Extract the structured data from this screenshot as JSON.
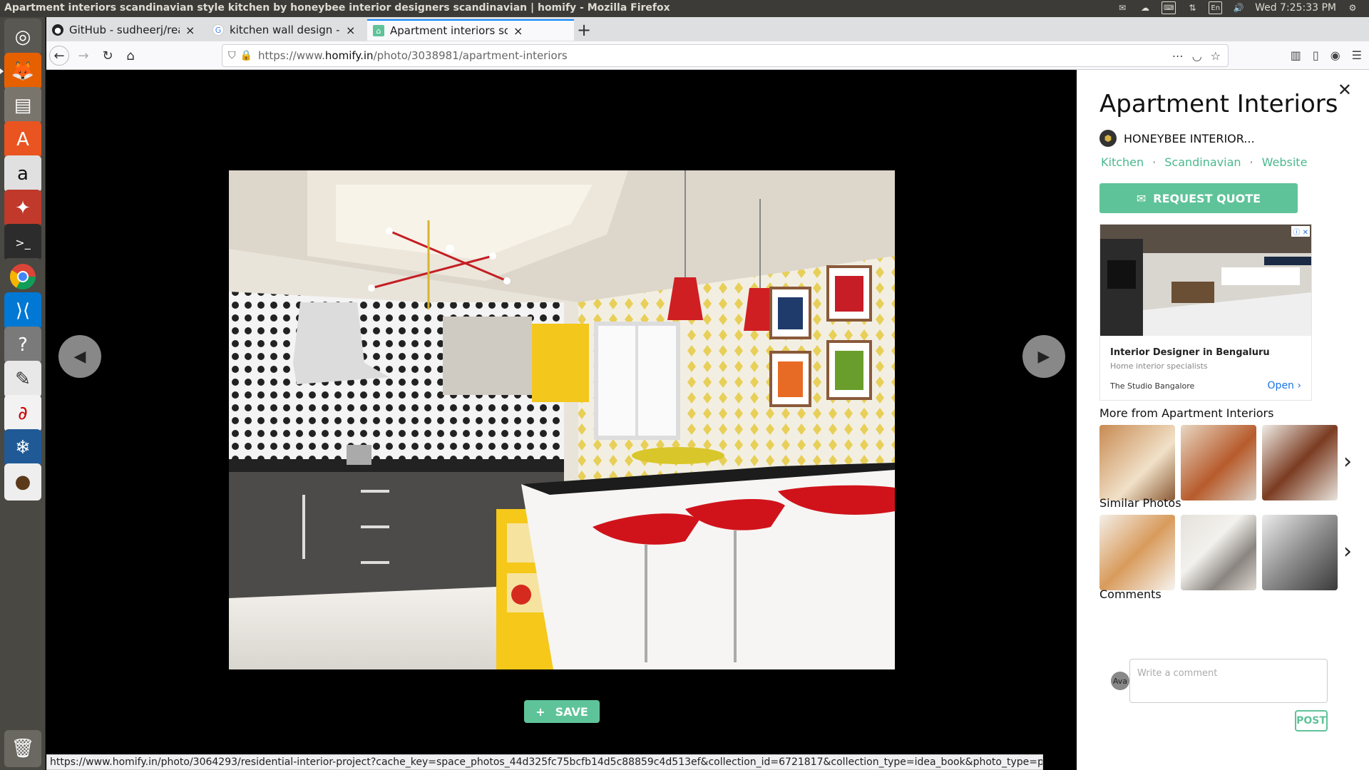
{
  "os": {
    "window_title": "Apartment interiors scandinavian style kitchen by honeybee interior designers scandinavian | homify - Mozilla Firefox",
    "indicators": [
      "En",
      "Wed  7:25:33 PM"
    ]
  },
  "launcher": {
    "items": [
      "ubuntu-dash-icon",
      "firefox-icon",
      "files-icon",
      "software-center-icon",
      "amazon-icon",
      "settings-icon",
      "terminal-icon",
      "chrome-icon",
      "vscode-icon",
      "help-icon",
      "text-editor-icon",
      "evince-icon",
      "tree-app-icon",
      "squirrel-app-icon",
      "trash-icon"
    ]
  },
  "browser": {
    "tabs": [
      {
        "label": "GitHub - sudheerj/reactj"
      },
      {
        "label": "kitchen wall design - Goo"
      },
      {
        "label": "Apartment interiors scandi"
      }
    ],
    "url_prefix": "https://www.",
    "url_host": "homify.in",
    "url_path": "/photo/3038981/apartment-interiors",
    "status_url": "https://www.homify.in/photo/3064293/residential-interior-project?cache_key=space_photos_44d325fc75bcfb14d5c88859c4d513ef&collection_id=6721817&collection_type=idea_book&photo_type=photo"
  },
  "viewer": {
    "save_label": "SAVE"
  },
  "panel": {
    "title": "Apartment Interiors",
    "professional": "HONEYBEE INTERIOR...",
    "tags": [
      "Kitchen",
      "Scandinavian",
      "Website"
    ],
    "request_quote": "REQUEST QUOTE",
    "ad": {
      "title": "Interior Designer in Bengaluru",
      "subtitle": "Home interior specialists",
      "brand": "The Studio Bangalore",
      "cta": "Open"
    },
    "more_from": "More from Apartment Interiors",
    "similar": "Similar Photos",
    "comments": "Comments",
    "comment_placeholder": "Write a comment",
    "avatar": "Ava",
    "post": "POST"
  },
  "colors": {
    "accent": "#5fc399",
    "tag_link": "#4ab88f"
  }
}
